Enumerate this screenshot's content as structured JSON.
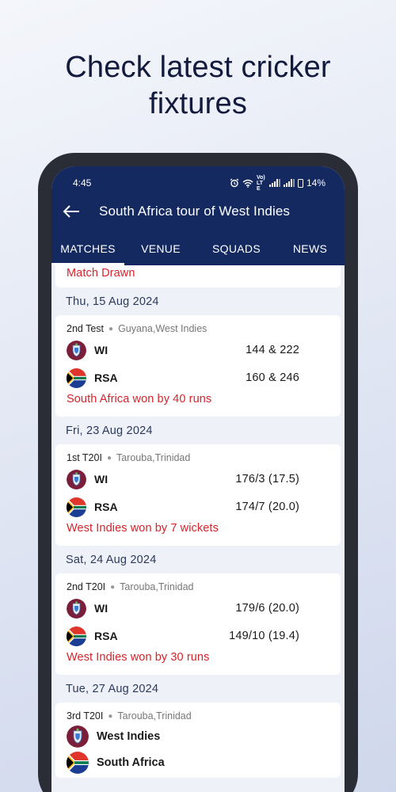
{
  "headline": {
    "line1": "Check latest cricker",
    "line2": "fixtures"
  },
  "status_bar": {
    "time": "4:45",
    "volte": "Vo) LTE",
    "battery": "14%"
  },
  "app_bar": {
    "title": "South Africa tour of West Indies"
  },
  "tabs": [
    {
      "label": "MATCHES",
      "active": true
    },
    {
      "label": "VENUE"
    },
    {
      "label": "SQUADS"
    },
    {
      "label": "NEWS"
    }
  ],
  "previous_result": "Match Drawn",
  "fixtures": [
    {
      "date": "Thu, 15 Aug 2024",
      "format": "2nd Test",
      "venue": "Guyana,West Indies",
      "team1": {
        "name": "WI",
        "score": "144 & 222"
      },
      "team2": {
        "name": "RSA",
        "score": "160 & 246"
      },
      "result": "South Africa won by 40 runs"
    },
    {
      "date": "Fri, 23 Aug 2024",
      "format": "1st T20I",
      "venue": "Tarouba,Trinidad",
      "team1": {
        "name": "WI",
        "score": "176/3 (17.5)"
      },
      "team2": {
        "name": "RSA",
        "score": "174/7 (20.0)"
      },
      "result": "West Indies won by 7 wickets"
    },
    {
      "date": "Sat, 24 Aug 2024",
      "format": "2nd T20I",
      "venue": "Tarouba,Trinidad",
      "team1": {
        "name": "WI",
        "score": "179/6 (20.0)"
      },
      "team2": {
        "name": "RSA",
        "score": "149/10 (19.4)"
      },
      "result": "West Indies won by 30 runs"
    },
    {
      "date": "Tue, 27 Aug 2024",
      "format": "3rd T20I",
      "venue": "Tarouba,Trinidad",
      "team1": {
        "name": "West Indies"
      },
      "team2": {
        "name": "South Africa"
      }
    }
  ],
  "colors": {
    "app_bar": "#13295f",
    "result_red": "#d8232a",
    "headline": "#121a3d"
  }
}
